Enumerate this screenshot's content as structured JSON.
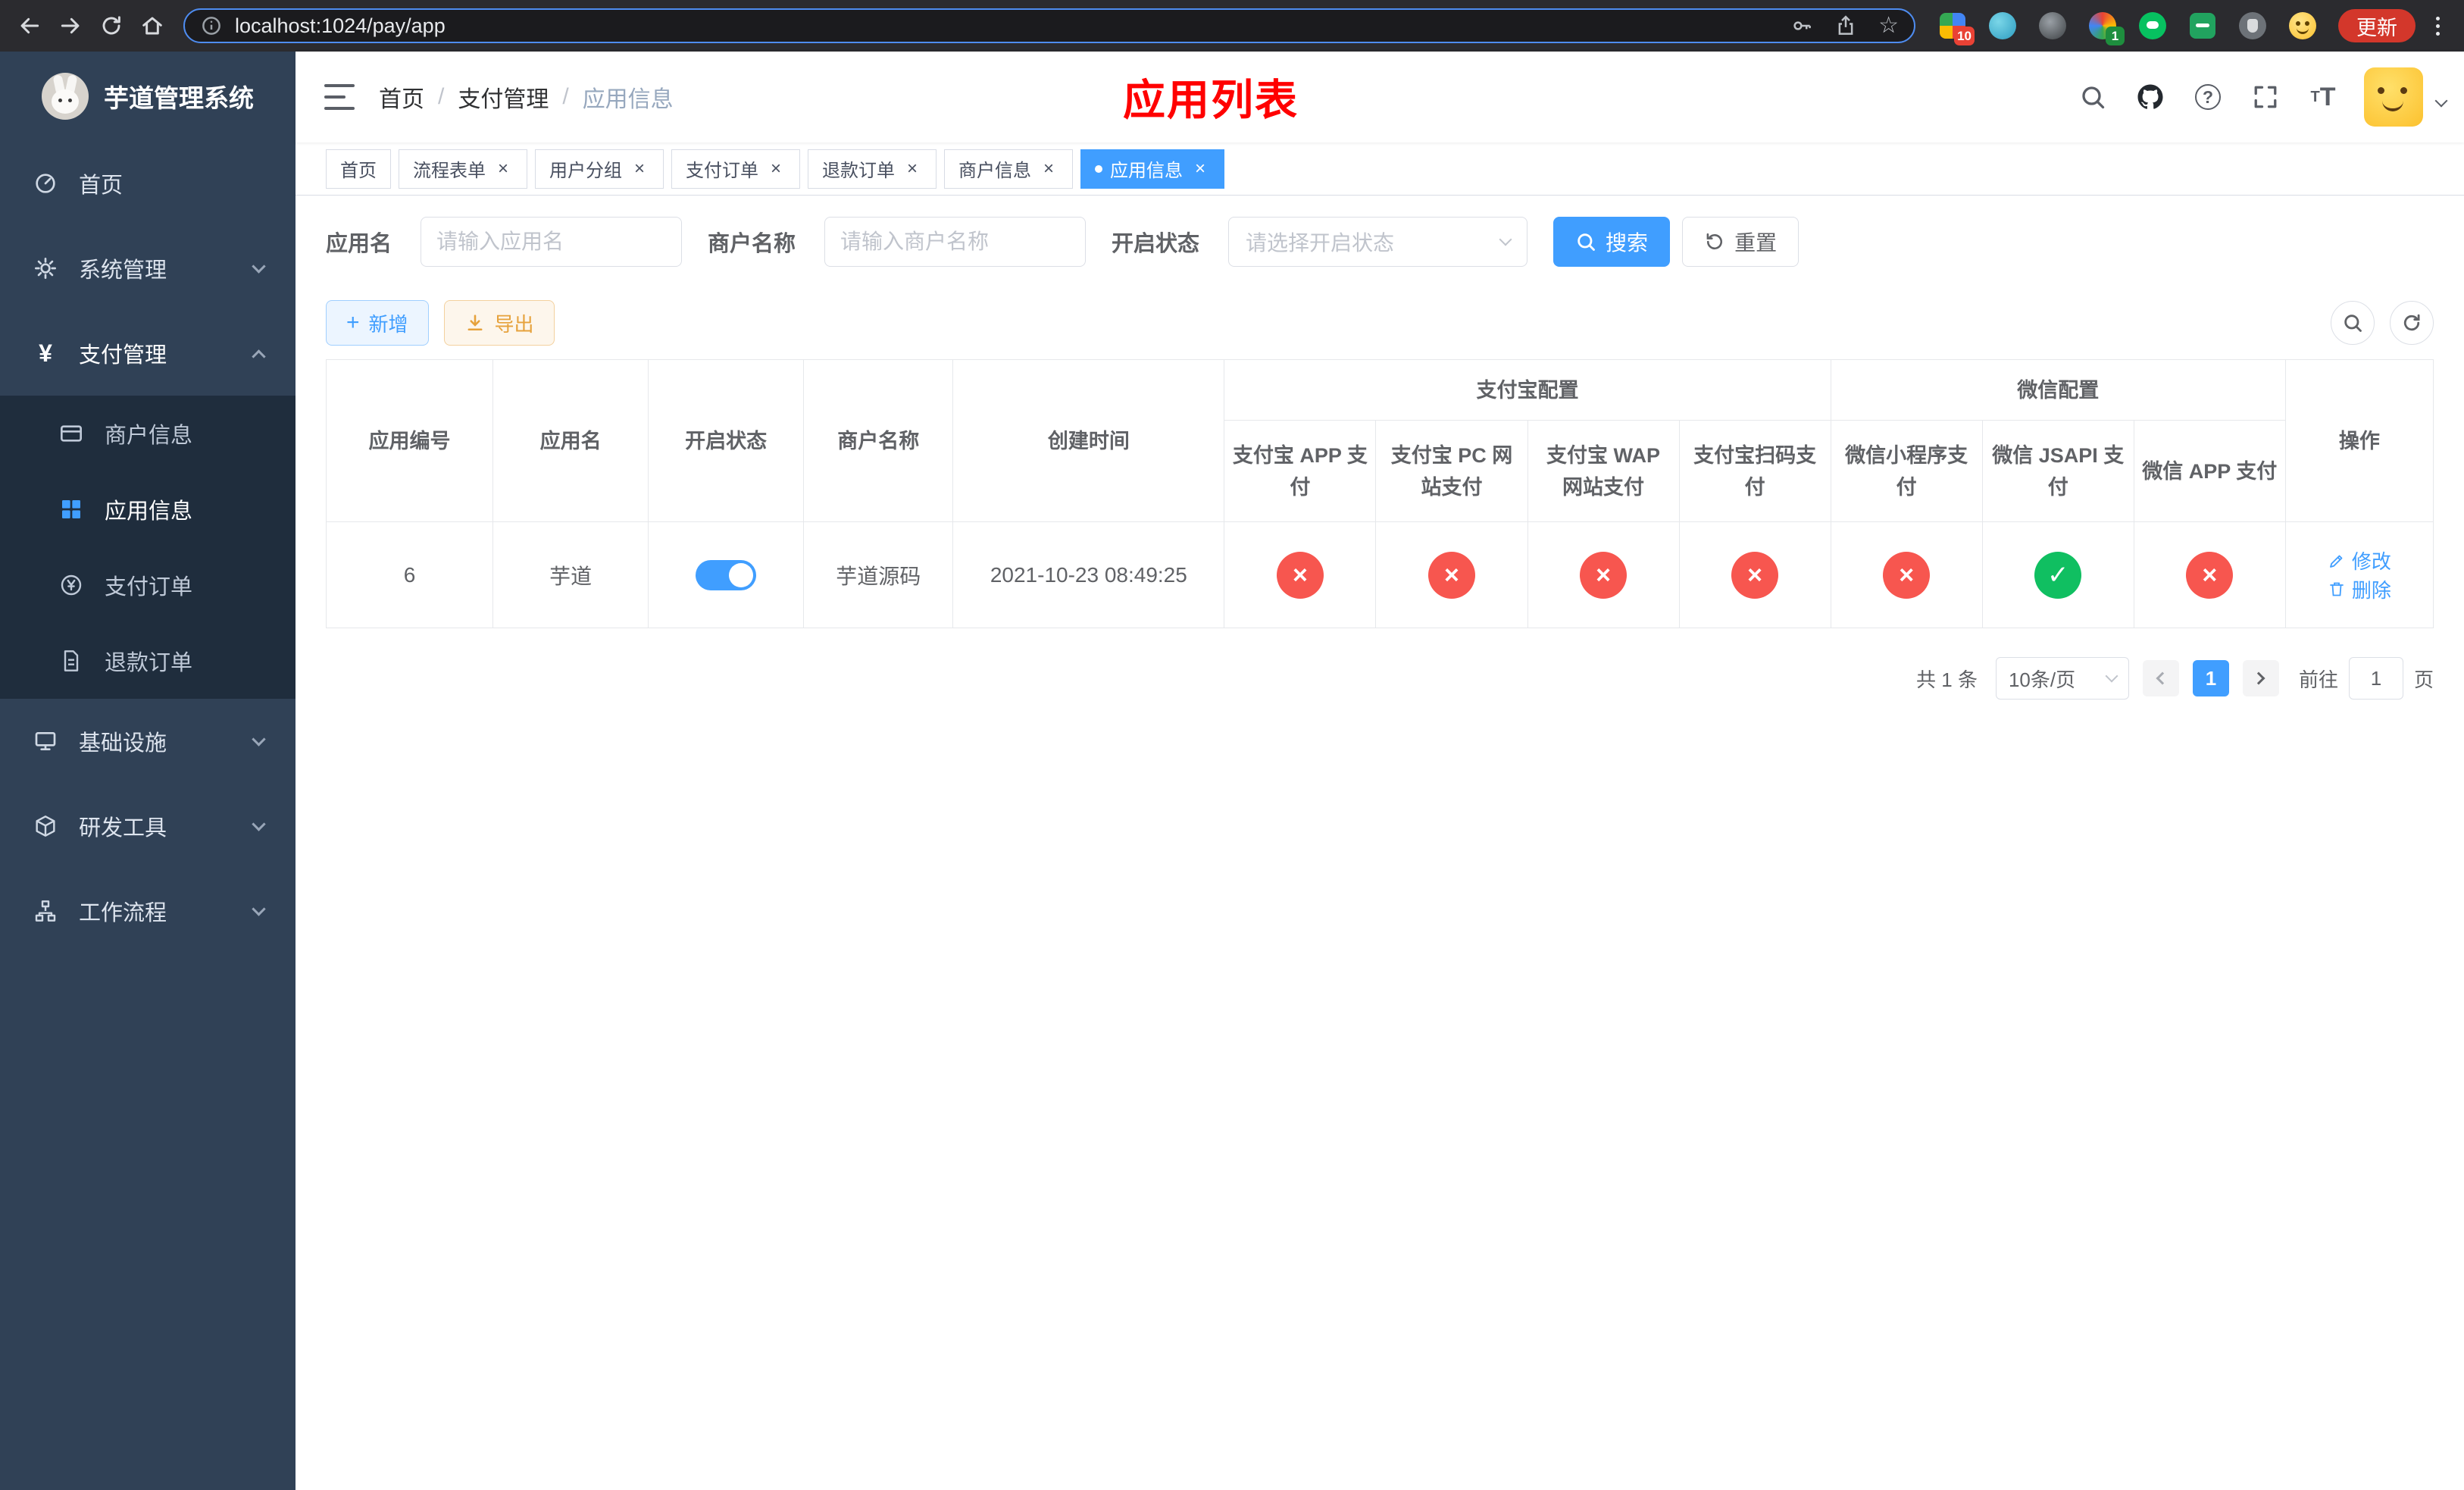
{
  "browser": {
    "url": "localhost:1024/pay/app",
    "update_label": "更新",
    "badge_1": "10",
    "badge_2": "1"
  },
  "icons": {
    "star": "☆",
    "help": "?",
    "close": "×",
    "plus": "+",
    "yen": "¥",
    "check": "✓",
    "cross": "×",
    "font": "T"
  },
  "sidebar": {
    "title": "芋道管理系统",
    "items": [
      {
        "label": "首页"
      },
      {
        "label": "系统管理"
      },
      {
        "label": "支付管理"
      },
      {
        "label": "基础设施"
      },
      {
        "label": "研发工具"
      },
      {
        "label": "工作流程"
      }
    ],
    "submenu": [
      {
        "label": "商户信息"
      },
      {
        "label": "应用信息",
        "active": true
      },
      {
        "label": "支付订单"
      },
      {
        "label": "退款订单"
      }
    ]
  },
  "navbar": {
    "breadcrumb": [
      "首页",
      "支付管理",
      "应用信息"
    ],
    "separator": "/",
    "overlay_title": "应用列表"
  },
  "tabs": [
    {
      "label": "首页",
      "closable": false,
      "active": false
    },
    {
      "label": "流程表单",
      "closable": true,
      "active": false
    },
    {
      "label": "用户分组",
      "closable": true,
      "active": false
    },
    {
      "label": "支付订单",
      "closable": true,
      "active": false
    },
    {
      "label": "退款订单",
      "closable": true,
      "active": false
    },
    {
      "label": "商户信息",
      "closable": true,
      "active": false
    },
    {
      "label": "应用信息",
      "closable": true,
      "active": true
    }
  ],
  "filters": {
    "app_name_label": "应用名",
    "app_name_placeholder": "请输入应用名",
    "merchant_label": "商户名称",
    "merchant_placeholder": "请输入商户名称",
    "status_label": "开启状态",
    "status_placeholder": "请选择开启状态",
    "search_button": "搜索",
    "reset_button": "重置"
  },
  "toolbar": {
    "add_label": "新增",
    "export_label": "导出"
  },
  "table": {
    "headers": {
      "app_id": "应用编号",
      "app_name": "应用名",
      "status": "开启状态",
      "merchant": "商户名称",
      "created": "创建时间",
      "alipay_group": "支付宝配置",
      "wechat_group": "微信配置",
      "alipay_app": "支付宝 APP 支付",
      "alipay_pc": "支付宝 PC 网站支付",
      "alipay_wap": "支付宝 WAP 网站支付",
      "alipay_qr": "支付宝扫码支付",
      "wechat_mini": "微信小程序支付",
      "wechat_jsapi": "微信 JSAPI 支付",
      "wechat_app": "微信 APP 支付",
      "actions": "操作"
    },
    "row": {
      "id": "6",
      "name": "芋道",
      "status_on": true,
      "merchant": "芋道源码",
      "created": "2021-10-23 08:49:25",
      "configs": [
        false,
        false,
        false,
        false,
        false,
        true,
        false
      ],
      "edit_label": "修改",
      "delete_label": "删除"
    }
  },
  "pagination": {
    "total": "共 1 条",
    "page_size": "10条/页",
    "current": "1",
    "goto_label": "前往",
    "goto_value": "1",
    "unit": "页"
  },
  "colors": {
    "primary": "#409EFF",
    "success": "#10BF61",
    "danger": "#F7564F",
    "warning": "#E6A23C",
    "annotation_red": "#FF0000",
    "sidebar_bg": "#304156",
    "submenu_bg": "#1F2D3D"
  }
}
